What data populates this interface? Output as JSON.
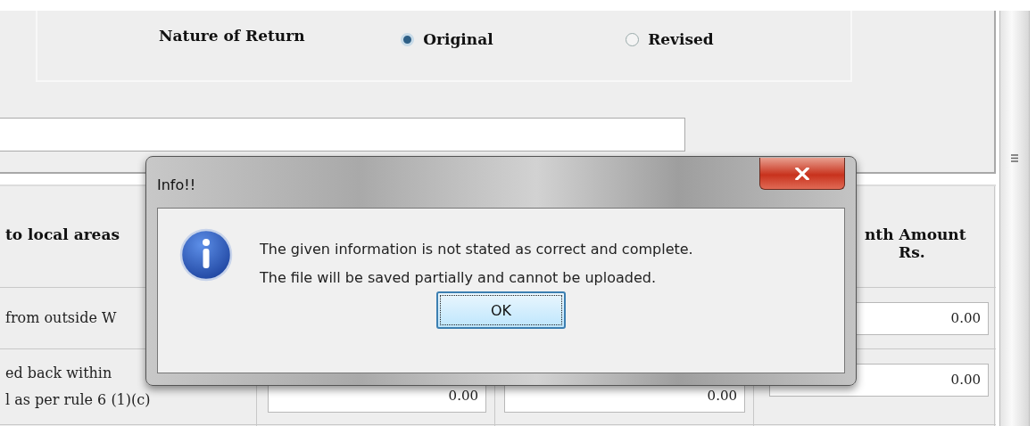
{
  "return_panel": {
    "label": "Nature of Return",
    "options": [
      {
        "label": "Original",
        "selected": true
      },
      {
        "label": "Revised",
        "selected": false
      }
    ]
  },
  "table": {
    "header": {
      "column_1": "to local areas",
      "column_4": [
        "nth Amount",
        "Rs."
      ]
    },
    "rows": [
      {
        "label_lines": [
          "from outside W"
        ],
        "column_4": "0.00"
      },
      {
        "label_lines": [
          "ed back within",
          "l as per rule 6 (1)(c)"
        ],
        "column_2": "0.00",
        "column_3": "0.00",
        "column_4": "0.00"
      }
    ]
  },
  "dialog": {
    "title": "Info!!",
    "message_lines": [
      "The given information is not stated as correct and complete.",
      "The file will be saved partially and cannot be uploaded."
    ],
    "button": "OK"
  }
}
